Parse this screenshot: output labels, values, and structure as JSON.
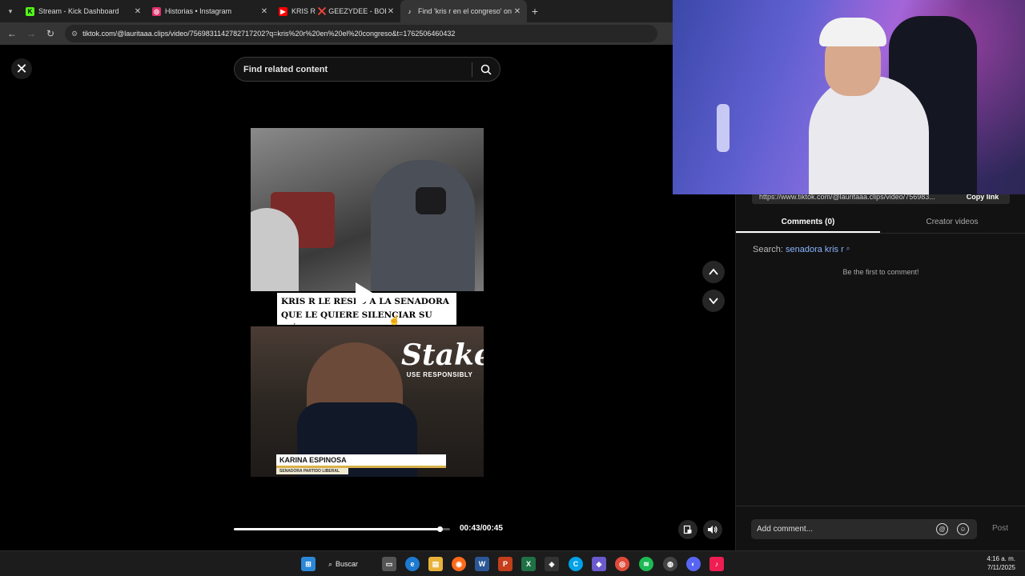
{
  "browser": {
    "tabs": [
      {
        "title": "Stream - Kick Dashboard",
        "icon": "kick-icon",
        "color": "#53fc18",
        "active": false
      },
      {
        "title": "Historias • Instagram",
        "icon": "instagram-icon",
        "color": "#e1306c",
        "active": false
      },
      {
        "title": "KRIS R ❌ GEEZYDEE - BOBADI",
        "icon": "youtube-icon",
        "color": "#ff0000",
        "active": false
      },
      {
        "title": "Find 'kris r en el congreso' on T",
        "icon": "tiktok-icon",
        "color": "#ffffff",
        "active": true
      }
    ],
    "url": "tiktok.com/@lauritaaa.clips/video/7569831142782717202?q=kris%20r%20en%20el%20congreso&t=1762506460432"
  },
  "page": {
    "search_placeholder": "Find related content",
    "caption": "KRIS R LE RESPO     A LA SENADORA QUE LE QUIERE SILENCIAR SU MÚSICA",
    "sponsor": {
      "logo": "Stake",
      "tagline": "USE RESPONSIBLY"
    },
    "lower_third": {
      "name": "KARINA ESPINOSA",
      "role": "SENADORA PARTIDO LIBERAL"
    },
    "progress": {
      "fraction": 0.95,
      "time": "00:43/00:45"
    }
  },
  "panel": {
    "link": "https://www.tiktok.com/@lauritaaa.clips/video/756983...",
    "copy_label": "Copy link",
    "tabs": [
      "Comments (0)",
      "Creator videos"
    ],
    "search_label": "Search:",
    "search_term": "senadora kris r",
    "empty_text": "Be the first to comment!",
    "comment_placeholder": "Add comment...",
    "post_label": "Post"
  },
  "taskbar": {
    "search_label": "Buscar",
    "time": "4:16 a. m.",
    "date": "7/11/2025"
  }
}
